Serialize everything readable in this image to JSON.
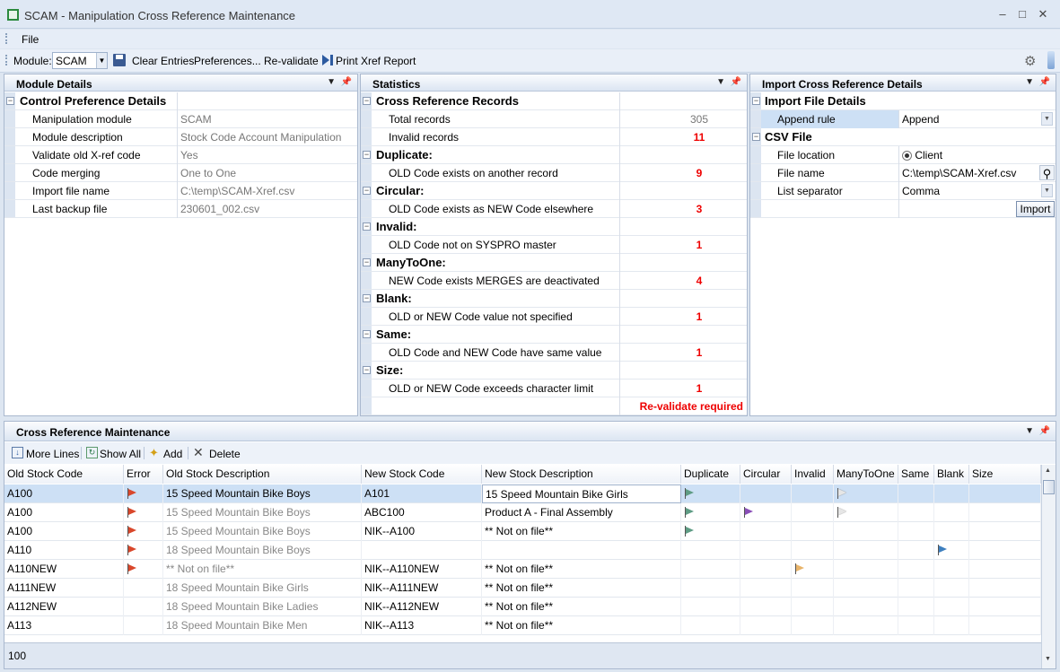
{
  "window": {
    "title": "SCAM - Manipulation Cross Reference Maintenance"
  },
  "menu": {
    "file": "File"
  },
  "toolbar": {
    "module_label": "Module:",
    "module_value": "SCAM",
    "clear_entries": "Clear Entries",
    "preferences": "Preferences...",
    "revalidate": "Re-validate",
    "print_report": "Print Xref Report"
  },
  "module_details": {
    "title": "Module Details",
    "section": "Control Preference Details",
    "rows": [
      {
        "label": "Manipulation module",
        "value": "SCAM"
      },
      {
        "label": "Module description",
        "value": "Stock Code Account Manipulation"
      },
      {
        "label": "Validate old X-ref code",
        "value": "Yes"
      },
      {
        "label": "Code merging",
        "value": "One to One"
      },
      {
        "label": "Import file name",
        "value": "C:\\temp\\SCAM-Xref.csv"
      },
      {
        "label": "Last backup file",
        "value": "230601_002.csv"
      }
    ]
  },
  "statistics": {
    "title": "Statistics",
    "rows": [
      {
        "cat": true,
        "label": "Cross Reference Records",
        "value": ""
      },
      {
        "cat": false,
        "label": "Total records",
        "value": "305",
        "gray": true
      },
      {
        "cat": false,
        "label": "Invalid records",
        "value": "11"
      },
      {
        "cat": true,
        "label": "Duplicate:",
        "value": ""
      },
      {
        "cat": false,
        "label": "OLD Code exists on another record",
        "value": "9"
      },
      {
        "cat": true,
        "label": "Circular:",
        "value": ""
      },
      {
        "cat": false,
        "label": "OLD Code exists as NEW Code elsewhere",
        "value": "3"
      },
      {
        "cat": true,
        "label": "Invalid:",
        "value": ""
      },
      {
        "cat": false,
        "label": "OLD Code not on SYSPRO master",
        "value": "1"
      },
      {
        "cat": true,
        "label": "ManyToOne:",
        "value": ""
      },
      {
        "cat": false,
        "label": "NEW Code exists MERGES are deactivated",
        "value": "4"
      },
      {
        "cat": true,
        "label": "Blank:",
        "value": ""
      },
      {
        "cat": false,
        "label": "OLD or NEW Code value not specified",
        "value": "1"
      },
      {
        "cat": true,
        "label": "Same:",
        "value": ""
      },
      {
        "cat": false,
        "label": "OLD Code and NEW Code have same value",
        "value": "1"
      },
      {
        "cat": true,
        "label": "Size:",
        "value": ""
      },
      {
        "cat": false,
        "label": "OLD or NEW Code exceeds character limit",
        "value": "1"
      }
    ],
    "revalidate_msg": "Re-validate required"
  },
  "import": {
    "title": "Import Cross Reference Details",
    "section1": "Import File Details",
    "append_rule_label": "Append rule",
    "append_rule_value": "Append",
    "section2": "CSV File",
    "file_location_label": "File location",
    "file_location_value": "Client",
    "file_name_label": "File name",
    "file_name_value": "C:\\temp\\SCAM-Xref.csv",
    "separator_label": "List separator",
    "separator_value": "Comma",
    "import_button": "Import"
  },
  "maintenance": {
    "title": "Cross Reference Maintenance",
    "more_lines": "More Lines",
    "show_all": "Show All",
    "add": "Add",
    "delete": "Delete",
    "columns": [
      "Old Stock Code",
      "Error",
      "Old Stock Description",
      "New Stock Code",
      "New Stock Description",
      "Duplicate",
      "Circular",
      "Invalid",
      "ManyToOne",
      "Same",
      "Blank",
      "Size"
    ],
    "rows": [
      {
        "old": "A100",
        "error": true,
        "old_desc": "15 Speed Mountain Bike Boys",
        "old_desc_dark": true,
        "new": "A101",
        "new_desc": "15 Speed Mountain Bike Girls",
        "flags": {
          "dup": "#5e9c84",
          "m2o": "#e6e6e6"
        }
      },
      {
        "old": "A100",
        "error": true,
        "old_desc": "15 Speed Mountain Bike Boys",
        "new": "ABC100",
        "new_desc": "Product A - Final Assembly",
        "flags": {
          "dup": "#5e9c84",
          "circ": "#8a4fb8",
          "m2o": "#e6e6e6"
        }
      },
      {
        "old": "A100",
        "error": true,
        "old_desc": "15 Speed Mountain Bike Boys",
        "new": "NIK--A100",
        "new_desc": "** Not on file**",
        "flags": {
          "dup": "#5e9c84"
        }
      },
      {
        "old": "A110",
        "error": true,
        "old_desc": "18 Speed Mountain Bike Boys",
        "new": "",
        "new_desc": "",
        "flags": {
          "blank": "#3d7fbf"
        }
      },
      {
        "old": "A110NEW",
        "error": true,
        "old_desc": "** Not on file**",
        "new": "NIK--A110NEW",
        "new_desc": "** Not on file**",
        "flags": {
          "inv": "#e8b46a"
        }
      },
      {
        "old": "A111NEW",
        "error": false,
        "old_desc": "18 Speed Mountain Bike Girls",
        "new": "NIK--A111NEW",
        "new_desc": "** Not on file**",
        "flags": {}
      },
      {
        "old": "A112NEW",
        "error": false,
        "old_desc": "18 Speed Mountain Bike Ladies",
        "new": "NIK--A112NEW",
        "new_desc": "** Not on file**",
        "flags": {}
      },
      {
        "old": "A113",
        "error": false,
        "old_desc": "18 Speed Mountain Bike Men",
        "new": "NIK--A113",
        "new_desc": "** Not on file**",
        "flags": {}
      }
    ],
    "footer_count": "100"
  },
  "colors": {
    "error_flag": "#d9472b",
    "selected_row": "#cde0f5"
  }
}
